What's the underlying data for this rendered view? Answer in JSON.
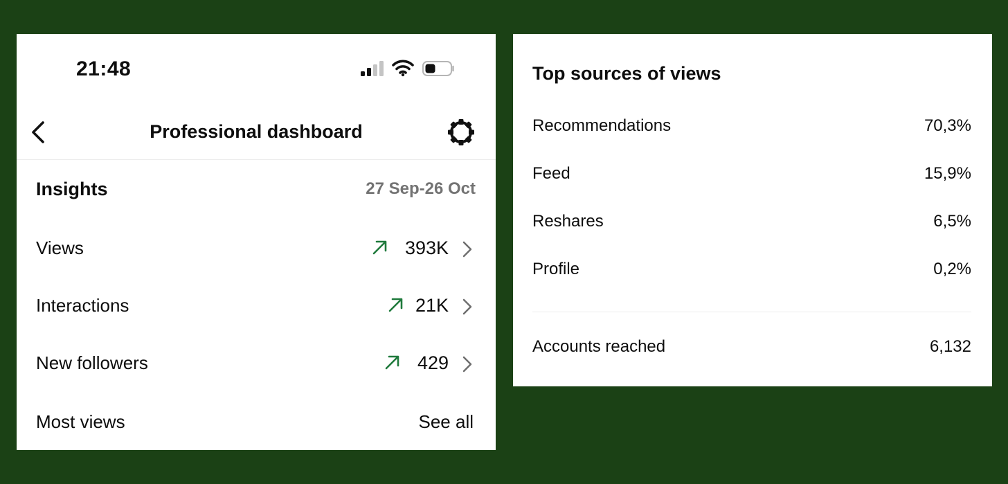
{
  "left_panel": {
    "status_bar": {
      "time": "21:48"
    },
    "header": {
      "title": "Professional dashboard"
    },
    "insights": {
      "title": "Insights",
      "date_range": "27 Sep-26 Oct",
      "metrics": [
        {
          "label": "Views",
          "value": "393K",
          "trend": "up",
          "icon": "trend-up-icon"
        },
        {
          "label": "Interactions",
          "value": "21K",
          "trend": "up",
          "icon": "trend-up-icon"
        },
        {
          "label": "New followers",
          "value": "429",
          "trend": "up",
          "icon": "trend-up-icon"
        }
      ]
    },
    "most_views": {
      "label": "Most views",
      "action": "See all"
    }
  },
  "right_panel": {
    "title": "Top sources of views",
    "sources": [
      {
        "label": "Recommendations",
        "value": "70,3%"
      },
      {
        "label": "Feed",
        "value": "15,9%"
      },
      {
        "label": "Reshares",
        "value": "6,5%"
      },
      {
        "label": "Profile",
        "value": "0,2%"
      }
    ],
    "accounts_reached": {
      "label": "Accounts reached",
      "value": "6,132"
    }
  },
  "colors": {
    "background": "#1b4115",
    "trend_green": "#1f7a3c",
    "muted_text": "#737373"
  }
}
